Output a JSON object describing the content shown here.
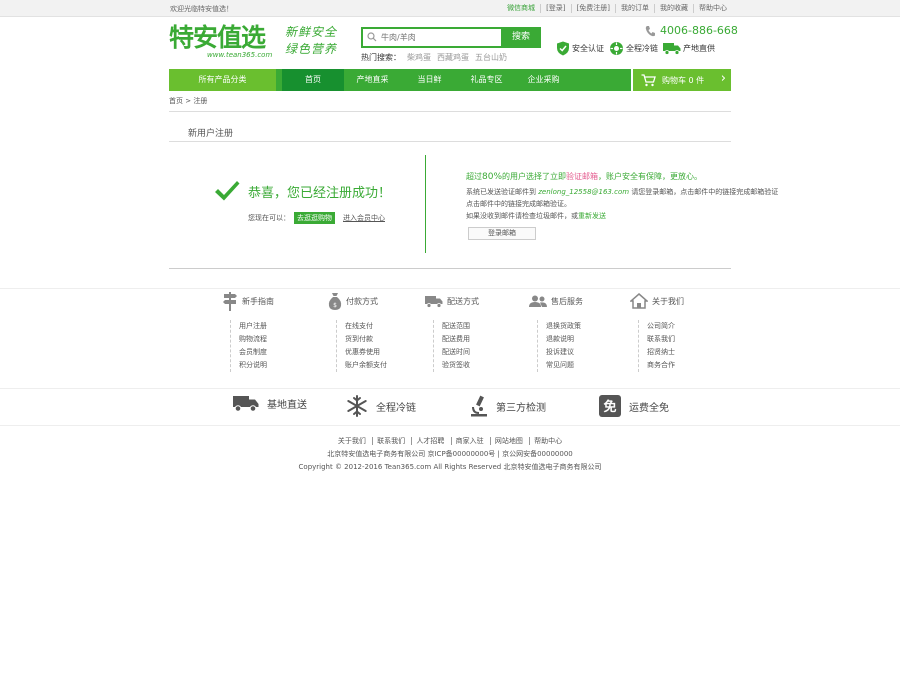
{
  "topbar": {
    "welcome": "欢迎光临特安值选！",
    "links": [
      "微信商城",
      "[登录]",
      "[免费注册]",
      "我的订单",
      "我的收藏",
      "帮助中心"
    ]
  },
  "header": {
    "logo": "特安值选",
    "logo_url": "www.tean365.com",
    "slogan_line1": "新鲜安全",
    "slogan_line2": "绿色营养",
    "search_placeholder": "牛肉/羊肉",
    "search_button": "搜索",
    "hot_label": "热门搜索：",
    "hot_items": [
      "柴鸡蛋",
      "西藏鸡蛋",
      "五台山奶"
    ],
    "hotline": "4006-886-668",
    "badges": [
      "安全认证",
      "全程冷链",
      "产地直供"
    ]
  },
  "nav": {
    "category": "所有产品分类",
    "items": [
      "首页",
      "产地直采",
      "当日鲜",
      "礼品专区",
      "企业采购"
    ],
    "cart": "购物车 0 件"
  },
  "breadcrumb": "首页 > 注册",
  "register": {
    "title": "新用户注册",
    "success": "恭喜，您已经注册成功！",
    "next_label": "您现在可以：",
    "shop_btn": "去逛逛购物",
    "center_link": "进入会员中心",
    "verify_prefix": "超过",
    "verify_num": "80%",
    "verify_mid": "的用户选择了立即",
    "verify_pink": "验证邮箱",
    "verify_suffix": "，账户安全有保障，更放心。",
    "line1_a": "系统已发送验证邮件到",
    "line1_email": "zenlong_12558@163.com",
    "line1_b": "请您登录邮箱，点击邮件中的链接完成邮箱验证",
    "line2": "点击邮件中的链接完成邮箱验证。",
    "line3_a": "如果没收到邮件请检查垃圾邮件，或",
    "line3_link": "重新发送",
    "login_btn": "登录邮箱"
  },
  "help": [
    {
      "title": "新手指南",
      "items": [
        "用户注册",
        "购物流程",
        "会员制度",
        "积分说明"
      ]
    },
    {
      "title": "付款方式",
      "items": [
        "在线支付",
        "货到付款",
        "优惠券使用",
        "账户余额支付"
      ]
    },
    {
      "title": "配送方式",
      "items": [
        "配送范围",
        "配送费用",
        "配送时间",
        "验货签收"
      ]
    },
    {
      "title": "售后服务",
      "items": [
        "退换货政策",
        "退款说明",
        "投诉建议",
        "常见问题"
      ]
    },
    {
      "title": "关于我们",
      "items": [
        "公司简介",
        "联系我们",
        "招贤纳士",
        "商务合作"
      ]
    }
  ],
  "features": [
    "基地直送",
    "全程冷链",
    "第三方检测",
    "运费全免"
  ],
  "footer": {
    "links": [
      "关于我们",
      "联系我们",
      "人才招聘",
      "商家入驻",
      "网站地图",
      "帮助中心"
    ],
    "line2": "北京特安值选电子商务有限公司  京ICP备00000000号  |  京公网安备00000000",
    "line3": "Copyright © 2012-2016 Tean365.com All Rights Reserved  北京特安值选电子商务有限公司"
  },
  "colors": {
    "brand": "#3aaa35",
    "nav_light": "#6abf2f",
    "nav_active": "#17902f",
    "accent_pink": "#e45c8f"
  }
}
